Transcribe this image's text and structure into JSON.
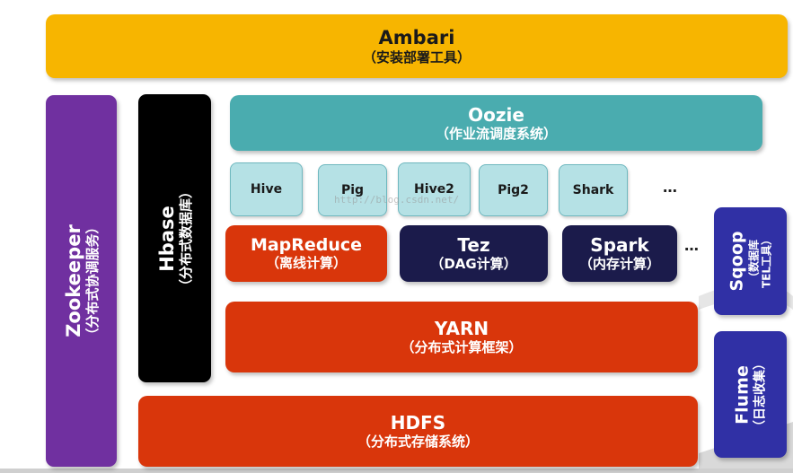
{
  "colors": {
    "ambari": "#f7b500",
    "zookeeper": "#7030a0",
    "hbase": "#000000",
    "oozie": "#4aacaf",
    "engine_light": "#b5e1e5",
    "mapreduce": "#d9360b",
    "navy": "#1b1b4b",
    "yarn": "#d9360b",
    "hdfs": "#d9360b",
    "sqoop_flume": "#3030a5"
  },
  "ambari": {
    "title": "Ambari",
    "subtitle": "（安装部署工具）"
  },
  "zookeeper": {
    "title": "Zookeeper",
    "subtitle": "（分布式协调服务）"
  },
  "hbase": {
    "title": "Hbase",
    "subtitle": "（分布式数据库）"
  },
  "oozie": {
    "title": "Oozie",
    "subtitle": "（作业流调度系统）"
  },
  "engines": [
    "Hive",
    "Pig",
    "Hive2",
    "Pig2",
    "Shark"
  ],
  "engines_more": "…",
  "mapreduce": {
    "title": "MapReduce",
    "subtitle": "（离线计算）"
  },
  "tez": {
    "title": "Tez",
    "subtitle": "（DAG计算）"
  },
  "spark": {
    "title": "Spark",
    "subtitle": "（内存计算）"
  },
  "compute_more": "…",
  "yarn": {
    "title": "YARN",
    "subtitle": "（分布式计算框架）"
  },
  "hdfs": {
    "title": "HDFS",
    "subtitle": "（分布式存储系统）"
  },
  "sqoop": {
    "title": "Sqoop",
    "subtitle_line1": "（数据库",
    "subtitle_line2": "TEL工具）"
  },
  "flume": {
    "title": "Flume",
    "subtitle": "（日志收集）"
  },
  "watermark": "http://blog.csdn.net/"
}
